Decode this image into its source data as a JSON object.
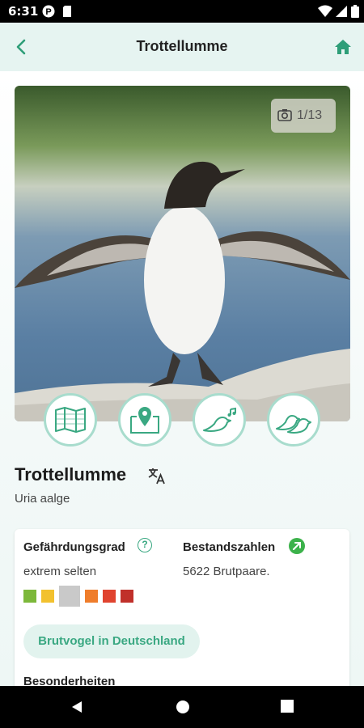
{
  "status_bar": {
    "time": "6:31"
  },
  "app_bar": {
    "title": "Trottellumme"
  },
  "photo": {
    "counter": "1/13"
  },
  "actions": [
    {
      "name": "map-button",
      "icon": "folded-map-icon"
    },
    {
      "name": "location-map-button",
      "icon": "map-pin-icon"
    },
    {
      "name": "bird-song-button",
      "icon": "singing-bird-icon"
    },
    {
      "name": "similar-birds-button",
      "icon": "two-birds-icon"
    }
  ],
  "bird": {
    "name": "Trottellumme",
    "latin": "Uria aalge"
  },
  "endangerment": {
    "label": "Gefährdungsgrad",
    "value": "extrem selten",
    "scale_colors": [
      "#7cb83a",
      "#f2c12e",
      "#c9c9c9",
      "#ef7d2b",
      "#e0432f",
      "#c0302a"
    ],
    "selected_index": 2
  },
  "population": {
    "label": "Bestandszahlen",
    "value": "5622 Brutpaare."
  },
  "badge": "Brutvogel in Deutschland",
  "features": {
    "label": "Besonderheiten"
  },
  "colors": {
    "accent": "#3aa882",
    "appbar": "#e6f4f1"
  }
}
